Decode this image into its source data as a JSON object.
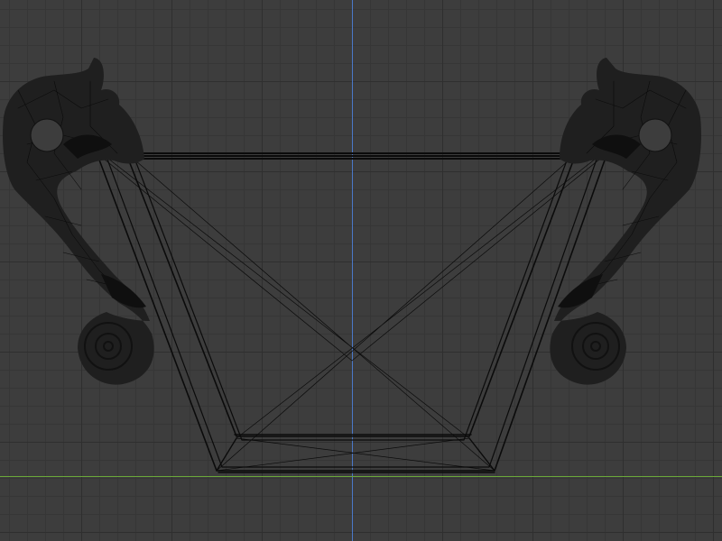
{
  "viewport": {
    "mode": "wireframe",
    "background_color": "#3d3d3d",
    "grid_color": "#2f2f2f",
    "axis_colors": {
      "z": "#4a78c8",
      "y": "#6aa83a"
    }
  },
  "scene": {
    "objects": [
      {
        "name": "vessel-body",
        "kind": "trapezoid-bowl"
      },
      {
        "name": "dragon-handle-left",
        "kind": "sculpted-handle"
      },
      {
        "name": "dragon-handle-right",
        "kind": "sculpted-handle"
      }
    ],
    "wire_color": "#0b0b0b",
    "mesh_shade": "#1f1f1f"
  }
}
